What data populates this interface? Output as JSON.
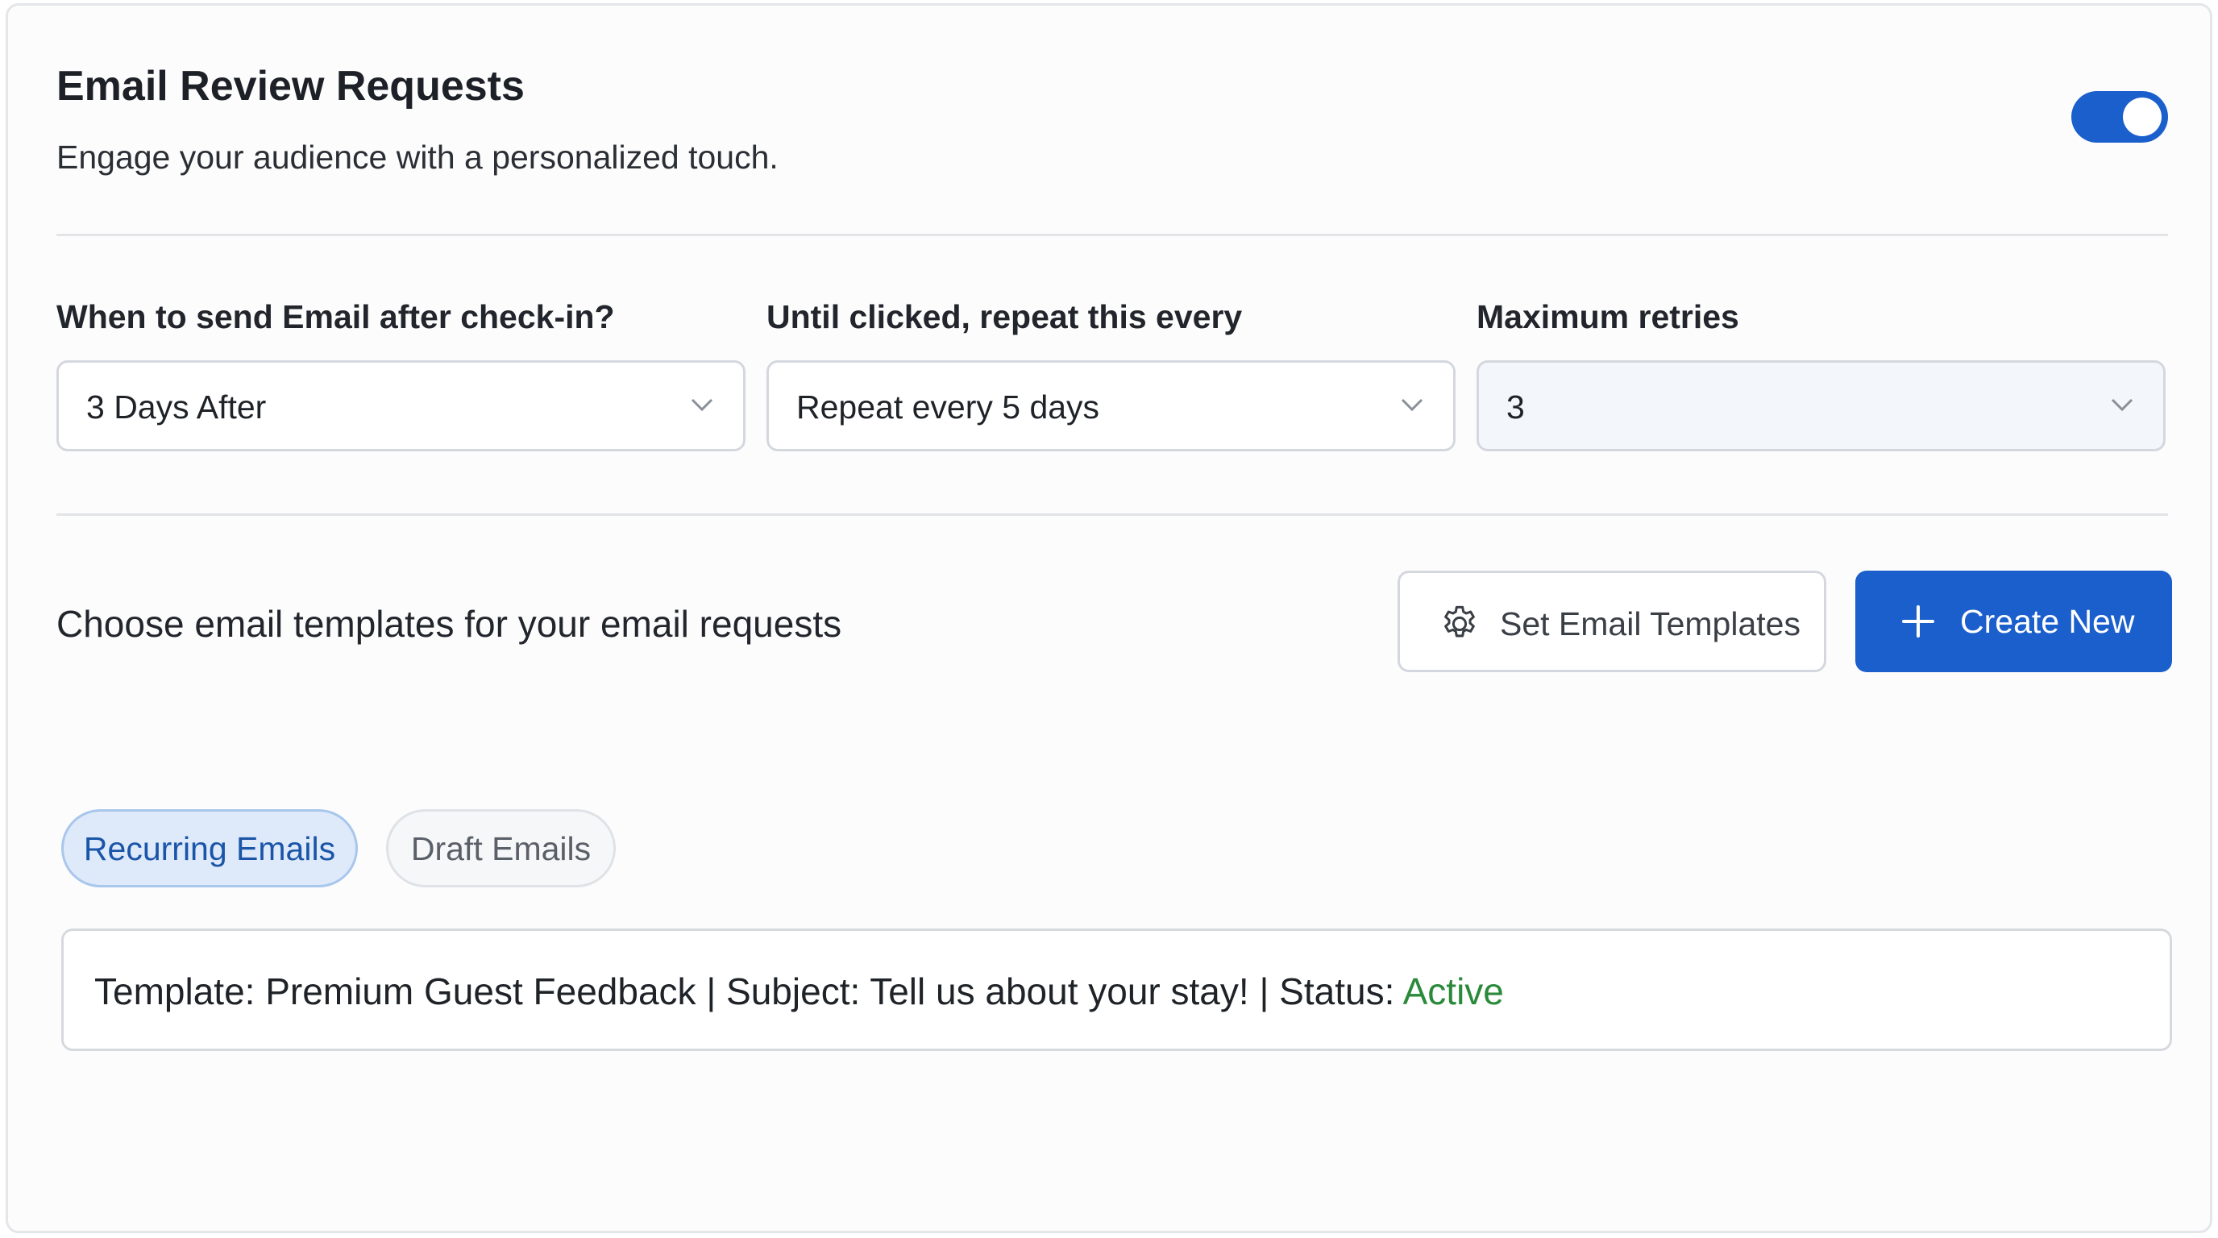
{
  "header": {
    "title": "Email Review Requests",
    "subtitle": "Engage your audience with a personalized touch.",
    "toggle_on": true
  },
  "settings": {
    "send_after": {
      "label": "When to send Email after check-in?",
      "value": "3 Days After"
    },
    "repeat": {
      "label": "Until clicked, repeat this every",
      "value": "Repeat every 5 days"
    },
    "max_retries": {
      "label": "Maximum retries",
      "value": "3"
    }
  },
  "templates": {
    "prompt": "Choose email templates for your email requests",
    "set_button": "Set Email Templates",
    "create_button": "Create New"
  },
  "tabs": [
    {
      "label": "Recurring Emails",
      "active": true
    },
    {
      "label": "Draft Emails",
      "active": false
    }
  ],
  "template_row": {
    "prefix": "Template: Premium Guest Feedback | Subject: Tell us about your stay! | Status: ",
    "status": "Active"
  },
  "colors": {
    "accent": "#1a5fcc",
    "active_status": "#2a8a3a"
  },
  "icons": [
    "gear-icon",
    "plus-icon",
    "chevron-down-icon"
  ]
}
